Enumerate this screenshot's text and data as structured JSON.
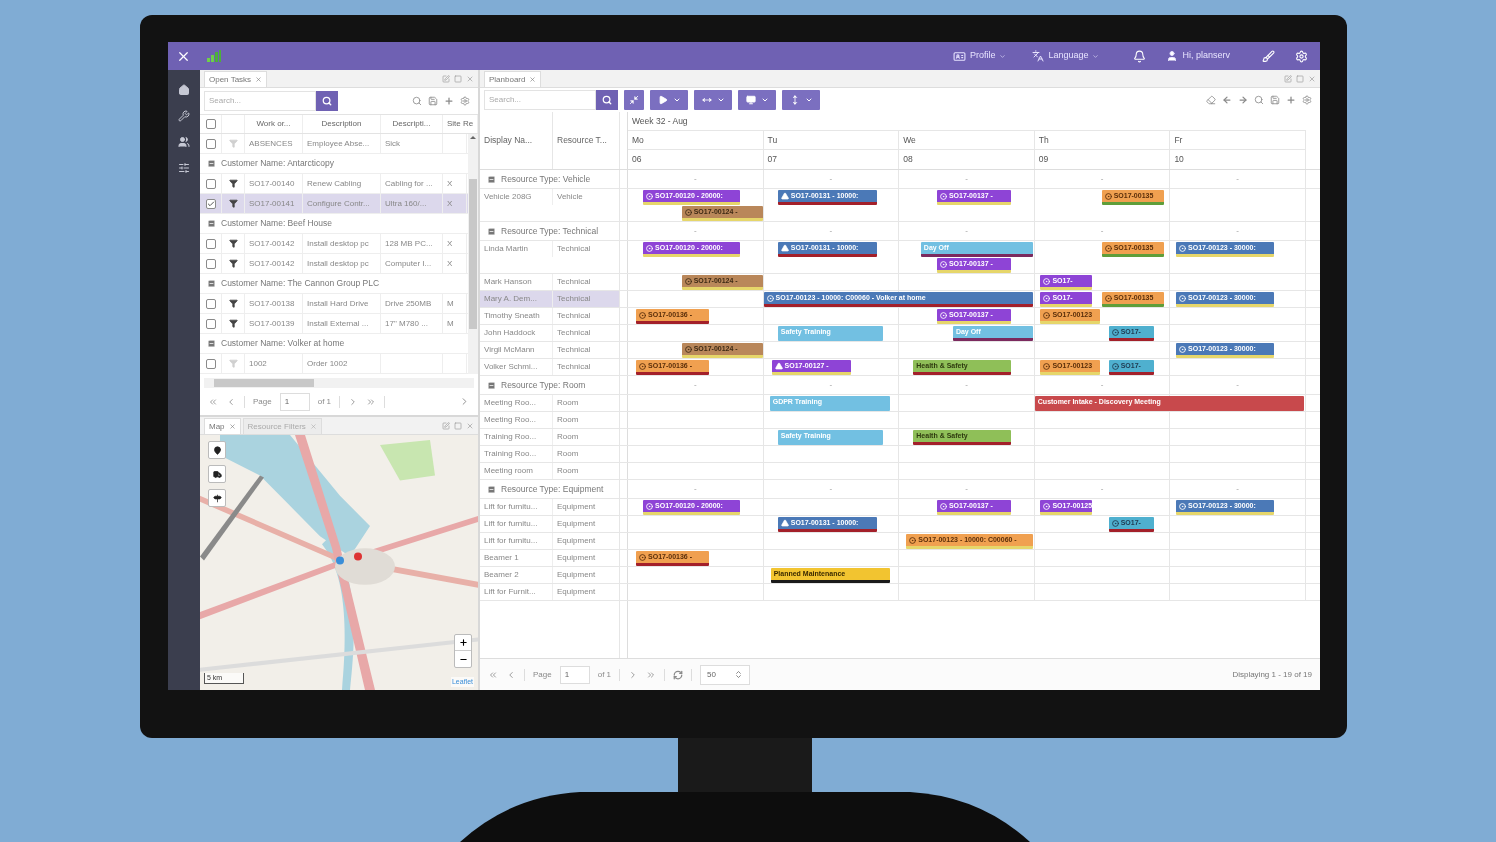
{
  "top_bar": {
    "menus": [
      {
        "kind": "profile",
        "label": "Profile"
      },
      {
        "kind": "language",
        "label": "Language"
      }
    ],
    "user": "Hi, planserv"
  },
  "open_tasks": {
    "tab": "Open Tasks",
    "search": {
      "placeholder": "Search..."
    },
    "all_checked": false,
    "columns": [
      "Work or...",
      "Description",
      "Descripti...",
      "Site Re"
    ],
    "rows": [
      {
        "kind": "task",
        "filter_active": false,
        "checked": false,
        "selected": false,
        "cells": [
          "ABSENCES",
          "Employee Abse...",
          "Sick"
        ]
      },
      {
        "kind": "group",
        "label": "Customer Name: Antarcticopy"
      },
      {
        "kind": "task",
        "filter_active": true,
        "checked": false,
        "selected": false,
        "cells": [
          "SO17-00140",
          "Renew Cabling",
          "Cabling for ...",
          "X"
        ]
      },
      {
        "kind": "task",
        "filter_active": true,
        "checked": true,
        "selected": true,
        "cells": [
          "SO17-00141",
          "Configure Contr...",
          "Ultra 160/...",
          "X"
        ]
      },
      {
        "kind": "group",
        "label": "Customer Name: Beef House"
      },
      {
        "kind": "task",
        "filter_active": true,
        "checked": false,
        "selected": false,
        "cells": [
          "SO17-00142",
          "Install desktop pc",
          "128 MB PC...",
          "X"
        ]
      },
      {
        "kind": "task",
        "filter_active": true,
        "checked": false,
        "selected": false,
        "cells": [
          "SO17-00142",
          "Install desktop pc",
          "Computer I...",
          "X"
        ]
      },
      {
        "kind": "group",
        "label": "Customer Name: The Cannon Group PLC"
      },
      {
        "kind": "task",
        "filter_active": true,
        "checked": false,
        "selected": false,
        "cells": [
          "SO17-00138",
          "Install Hard Drive",
          "Drive 250MB",
          "M"
        ]
      },
      {
        "kind": "task",
        "filter_active": true,
        "checked": false,
        "selected": false,
        "cells": [
          "SO17-00139",
          "Install External ...",
          "17\" M780 ...",
          "M"
        ]
      },
      {
        "kind": "group",
        "label": "Customer Name: Volker at home"
      },
      {
        "kind": "task",
        "filter_active": false,
        "checked": false,
        "selected": false,
        "cells": [
          "1002",
          "Order 1002"
        ]
      }
    ],
    "pager": {
      "page_label": "Page",
      "page": "1",
      "of": "of 1"
    }
  },
  "map_panel": {
    "tabs": [
      {
        "label": "Map",
        "selected": true
      },
      {
        "label": "Resource Filters",
        "selected": false
      }
    ],
    "scale": "5 km",
    "attribution": "Leaflet"
  },
  "planboard": {
    "tab": "Planboard",
    "search": {
      "placeholder": "Search..."
    },
    "columns": [
      "Display Na...",
      "Resource T..."
    ],
    "week": "Week 32 - Aug",
    "days": [
      {
        "name": "Mo",
        "date": "06"
      },
      {
        "name": "Tu",
        "date": "07"
      },
      {
        "name": "We",
        "date": "08"
      },
      {
        "name": "Th",
        "date": "09"
      },
      {
        "name": "Fr",
        "date": "10"
      }
    ],
    "rows": [
      {
        "kind": "group",
        "label": "Resource Type: Vehicle",
        "marks": [
          "-",
          "-",
          "-",
          "-",
          "-"
        ]
      },
      {
        "kind": "resource",
        "name": "Vehicle 208G",
        "type": "Vehicle",
        "selected": false,
        "lanes": [
          [
            {
              "label": "SO17-00120 - 20000:",
              "kind": "order",
              "color": "#8e44d6"
            },
            {
              "label": "SO17-00131 - 10000:",
              "kind": "alert",
              "color": "#4b79b7"
            },
            {
              "label": "SO17-00137 -",
              "kind": "order",
              "color": "#8e44d6"
            },
            {
              "label": "SO17-00135",
              "kind": "order",
              "color": "#f0a050"
            }
          ],
          [
            {
              "label": "SO17-00124 -",
              "kind": "order",
              "color": "#b9875a"
            }
          ]
        ]
      },
      {
        "kind": "group",
        "label": "Resource Type: Technical",
        "marks": [
          "-",
          "-",
          "-",
          "-",
          "-"
        ]
      },
      {
        "kind": "resource",
        "name": "Linda Martin",
        "type": "Technical",
        "selected": false,
        "lanes": [
          [
            {
              "label": "SO17-00120 - 20000:",
              "kind": "order",
              "color": "#8e44d6"
            },
            {
              "label": "SO17-00131 - 10000:",
              "kind": "alert",
              "color": "#4b79b7"
            },
            {
              "label": "Day Off",
              "kind": "activity",
              "color": "#72c0e2"
            },
            {
              "label": "SO17-00135",
              "kind": "order",
              "color": "#f0a050"
            },
            {
              "label": "SO17-00123 - 30000:",
              "kind": "order",
              "color": "#4b79b7"
            }
          ],
          [
            {
              "label": "SO17-00137 -",
              "kind": "order",
              "color": "#8e44d6"
            }
          ]
        ]
      },
      {
        "kind": "resource",
        "name": "Mark Hanson",
        "type": "Technical",
        "selected": false,
        "lanes": [
          [
            {
              "label": "SO17-00124 -",
              "kind": "order",
              "color": "#b9875a"
            },
            {
              "label": "SO17-",
              "kind": "order",
              "color": "#8e44d6"
            }
          ]
        ]
      },
      {
        "kind": "resource",
        "name": "Mary A. Dem...",
        "type": "Technical",
        "selected": true,
        "lanes": [
          [
            {
              "label": "SO17-00123 - 10000: C00060 - Volker at home",
              "kind": "order",
              "color": "#4b79b7"
            },
            {
              "label": "SO17-",
              "kind": "order",
              "color": "#8e44d6"
            },
            {
              "label": "SO17-00135",
              "kind": "order",
              "color": "#f0a050"
            },
            {
              "label": "SO17-00123 - 30000:",
              "kind": "order",
              "color": "#4b79b7"
            }
          ]
        ]
      },
      {
        "kind": "resource",
        "name": "Timothy Sneath",
        "type": "Technical",
        "selected": false,
        "lanes": [
          [
            {
              "label": "SO17-00136 -",
              "kind": "order",
              "color": "#f0a050"
            },
            {
              "label": "SO17-00137 -",
              "kind": "order",
              "color": "#8e44d6"
            },
            {
              "label": "SO17-00123",
              "kind": "order",
              "color": "#f0a050"
            }
          ]
        ]
      },
      {
        "kind": "resource",
        "name": "John Haddock",
        "type": "Technical",
        "selected": false,
        "lanes": [
          [
            {
              "label": "Safety Training",
              "kind": "activity",
              "color": "#72c0e2"
            },
            {
              "label": "Day Off",
              "kind": "activity",
              "color": "#72c0e2"
            },
            {
              "label": "SO17-",
              "kind": "order",
              "color": "#4fb0cf"
            }
          ]
        ]
      },
      {
        "kind": "resource",
        "name": "Virgil McMann",
        "type": "Technical",
        "selected": false,
        "lanes": [
          [
            {
              "label": "SO17-00124 -",
              "kind": "order",
              "color": "#b9875a"
            },
            {
              "label": "SO17-00123 - 30000:",
              "kind": "order",
              "color": "#4b79b7"
            }
          ]
        ]
      },
      {
        "kind": "resource",
        "name": "Volker Schmi...",
        "type": "Technical",
        "selected": false,
        "lanes": [
          [
            {
              "label": "SO17-00136 -",
              "kind": "order",
              "color": "#f0a050"
            },
            {
              "label": "SO17-00127 -",
              "kind": "alert",
              "color": "#8e44d6"
            },
            {
              "label": "Health & Safety",
              "kind": "activity",
              "color": "#8fbf58"
            },
            {
              "label": "SO17-00123",
              "kind": "order",
              "color": "#f0a050"
            },
            {
              "label": "SO17-",
              "kind": "order",
              "color": "#4fb0cf"
            }
          ]
        ]
      },
      {
        "kind": "group",
        "label": "Resource Type: Room",
        "marks": [
          "-",
          "-",
          "-",
          "-",
          "-"
        ]
      },
      {
        "kind": "resource",
        "name": "Meeting Roo...",
        "type": "Room",
        "selected": false,
        "lanes": [
          [
            {
              "label": "GDPR Training",
              "kind": "activity",
              "color": "#72c0e2"
            },
            {
              "label": "Customer Intake - Discovery Meeting",
              "kind": "activity",
              "color": "#c8494c"
            }
          ]
        ]
      },
      {
        "kind": "resource",
        "name": "Meeting Roo...",
        "type": "Room",
        "selected": false
      },
      {
        "kind": "resource",
        "name": "Training Roo...",
        "type": "Room",
        "selected": false,
        "lanes": [
          [
            {
              "label": "Safety Training",
              "kind": "activity",
              "color": "#72c0e2"
            },
            {
              "label": "Health & Safety",
              "kind": "activity",
              "color": "#8fbf58"
            }
          ]
        ]
      },
      {
        "kind": "resource",
        "name": "Training Roo...",
        "type": "Room",
        "selected": false
      },
      {
        "kind": "resource",
        "name": "Meeting room",
        "type": "Room",
        "selected": false
      },
      {
        "kind": "group",
        "label": "Resource Type: Equipment",
        "marks": [
          "-",
          "-",
          "-",
          "-",
          "-"
        ]
      },
      {
        "kind": "resource",
        "name": "Lift for furnitu...",
        "type": "Equipment",
        "selected": false,
        "lanes": [
          [
            {
              "label": "SO17-00120 - 20000:",
              "kind": "order",
              "color": "#8e44d6"
            },
            {
              "label": "SO17-00137 -",
              "kind": "order",
              "color": "#8e44d6"
            },
            {
              "label": "SO17-00125",
              "kind": "order",
              "color": "#8e44d6"
            },
            {
              "label": "SO17-00123 - 30000:",
              "kind": "order",
              "color": "#4b79b7"
            }
          ]
        ]
      },
      {
        "kind": "resource",
        "name": "Lift for furnitu...",
        "type": "Equipment",
        "selected": false,
        "lanes": [
          [
            {
              "label": "SO17-00131 - 10000:",
              "kind": "alert",
              "color": "#4b79b7"
            },
            {
              "label": "SO17-",
              "kind": "order",
              "color": "#4fb0cf"
            }
          ]
        ]
      },
      {
        "kind": "resource",
        "name": "Lift for furnitu...",
        "type": "Equipment",
        "selected": false,
        "lanes": [
          [
            {
              "label": "SO17-00123 - 10000: C00060 -",
              "kind": "order",
              "color": "#f0a050"
            }
          ]
        ]
      },
      {
        "kind": "resource",
        "name": "Beamer 1",
        "type": "Equipment",
        "selected": false,
        "lanes": [
          [
            {
              "label": "SO17-00136 -",
              "kind": "order",
              "color": "#f0a050"
            }
          ]
        ]
      },
      {
        "kind": "resource",
        "name": "Beamer 2",
        "type": "Equipment",
        "selected": false,
        "lanes": [
          [
            {
              "label": "Planned Maintenance",
              "kind": "activity",
              "color": "#f2c430"
            }
          ]
        ]
      },
      {
        "kind": "resource",
        "name": "Lift for Furnit...",
        "type": "Equipment",
        "selected": false
      }
    ],
    "pager": {
      "page_label": "Page",
      "page": "1",
      "of": "of 1",
      "page_size": "50",
      "summary": "Displaying 1 - 19 of 19"
    }
  }
}
